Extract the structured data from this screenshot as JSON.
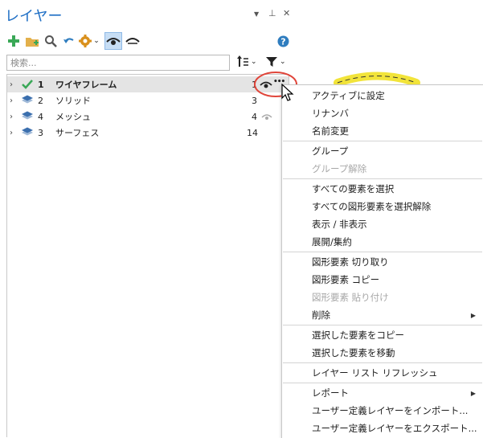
{
  "panel": {
    "title": "レイヤー",
    "pin_glyph": "⊥",
    "close_glyph": "✕",
    "dropdown_glyph": "▼"
  },
  "search": {
    "placeholder": "検索..."
  },
  "icons": {
    "add": "plus-icon",
    "new_folder": "folder-add-icon",
    "search": "magnifier-icon",
    "undo": "undo-arrow-icon",
    "settings": "gear-icon",
    "eye": "eye-icon",
    "eye_closed": "eye-closed-icon",
    "help": "help-icon",
    "sort": "sort-icon",
    "filter": "filter-icon"
  },
  "colors": {
    "accent": "#1f6fc5",
    "selected_row": "#e4e4e4",
    "highlight_circle": "#e0453a",
    "toggle_bg": "#c7def5",
    "check": "#3aa857",
    "layer_icon": "#3b6fae"
  },
  "layers": [
    {
      "expand": "›",
      "active": true,
      "number": "1",
      "name": "ワイヤフレーム",
      "count": "1"
    },
    {
      "expand": "›",
      "active": false,
      "number": "2",
      "name": "ソリッド",
      "count": "3"
    },
    {
      "expand": "›",
      "active": false,
      "number": "4",
      "name": "メッシュ",
      "count": "4"
    },
    {
      "expand": "›",
      "active": false,
      "number": "3",
      "name": "サーフェス",
      "count": "14"
    }
  ],
  "more_glyph": "•••",
  "menu": {
    "items": [
      {
        "label": "アクティブに設定",
        "disabled": false
      },
      {
        "label": "リナンバ",
        "disabled": false
      },
      {
        "label": "名前変更",
        "disabled": false
      },
      {
        "label": "グループ",
        "disabled": false
      },
      {
        "label": "グループ解除",
        "disabled": true
      },
      {
        "label": "すべての要素を選択",
        "disabled": false
      },
      {
        "label": "すべての図形要素を選択解除",
        "disabled": false
      },
      {
        "label": "表示 / 非表示",
        "disabled": false
      },
      {
        "label": "展開/集約",
        "disabled": false
      },
      {
        "label": "図形要素 切り取り",
        "disabled": false
      },
      {
        "label": "図形要素 コピー",
        "disabled": false
      },
      {
        "label": "図形要素 貼り付け",
        "disabled": true
      },
      {
        "label": "削除",
        "disabled": false,
        "submenu": "▶"
      },
      {
        "label": "選択した要素をコピー",
        "disabled": false
      },
      {
        "label": "選択した要素を移動",
        "disabled": false
      },
      {
        "label": "レイヤー リスト リフレッシュ",
        "disabled": false
      },
      {
        "label": "レポート",
        "disabled": false,
        "submenu": "▶"
      },
      {
        "label": "ユーザー定義レイヤーをインポート...",
        "disabled": false
      },
      {
        "label": "ユーザー定義レイヤーをエクスポート...",
        "disabled": false
      }
    ]
  }
}
